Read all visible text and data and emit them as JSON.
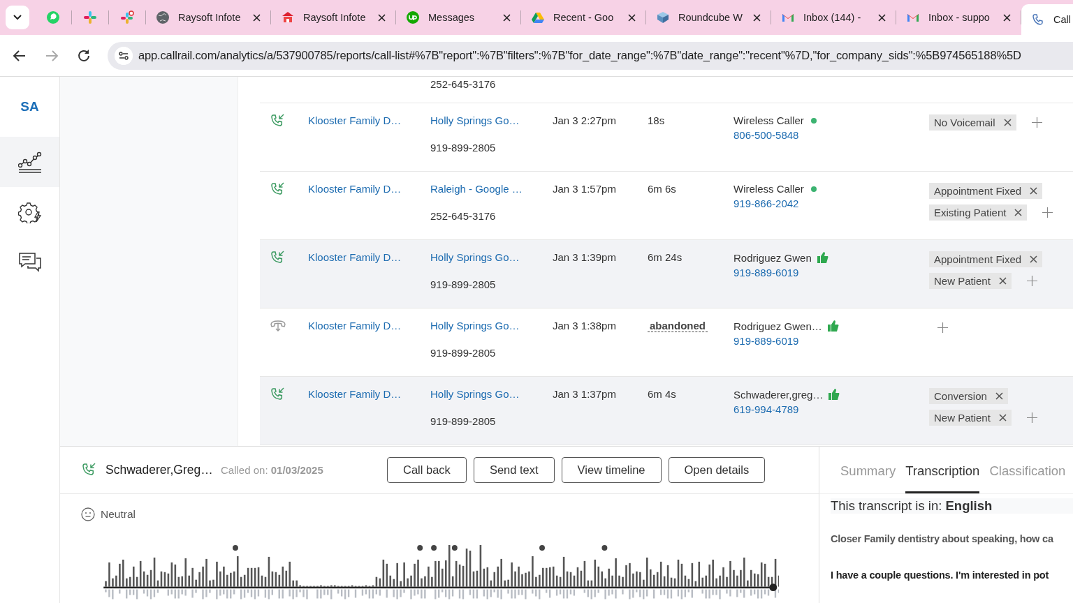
{
  "browser": {
    "tabs": [
      {
        "kind": "whatsapp",
        "selected": false
      },
      {
        "kind": "slack",
        "selected": false
      },
      {
        "kind": "slack_badge",
        "selected": false
      },
      {
        "kind": "globe",
        "title": "Raysoft Infote",
        "selected": false
      },
      {
        "kind": "portal",
        "title": "Raysoft Infote",
        "selected": false
      },
      {
        "kind": "upwork",
        "title": "Messages",
        "selected": false
      },
      {
        "kind": "drive",
        "title": "Recent - Goo",
        "selected": false
      },
      {
        "kind": "roundcube",
        "title": "Roundcube W",
        "selected": false
      },
      {
        "kind": "gmail",
        "title": "Inbox (144) -",
        "selected": false
      },
      {
        "kind": "gmail",
        "title": "Inbox - suppo",
        "selected": false
      },
      {
        "kind": "phone",
        "title": "Call",
        "selected": true
      }
    ],
    "url": "app.callrail.com/analytics/a/537900785/reports/call-list#%7B\"report\":%7B\"filters\":%7B\"for_date_range\":%7B\"date_range\":\"recent\"%7D,\"for_company_sids\":%5B974565188%5D"
  },
  "sidebar": {
    "account": "SA",
    "items": [
      {
        "kind": "analytics",
        "selected": true
      },
      {
        "kind": "settings",
        "selected": false
      },
      {
        "kind": "messages",
        "selected": false
      }
    ]
  },
  "calls": {
    "partial_row": {
      "tracking_number": "252-645-3176"
    },
    "rows": [
      {
        "kind": "answered",
        "highlighted": false,
        "company": "Klooster Family D…",
        "source": "Holly Springs Go…",
        "tracking_number": "919-899-2805",
        "time": "Jan 3 2:27pm",
        "duration": "18s",
        "caller": {
          "kind": "dot",
          "name": "Wireless Caller",
          "phone": "806-500-5848"
        },
        "tags": [
          "No Voicemail"
        ]
      },
      {
        "kind": "answered",
        "highlighted": false,
        "company": "Klooster Family D…",
        "source": "Raleigh - Google …",
        "tracking_number": "252-645-3176",
        "time": "Jan 3 1:57pm",
        "duration": "6m 6s",
        "caller": {
          "kind": "dot",
          "name": "Wireless Caller",
          "phone": "919-866-2042"
        },
        "tags": [
          "Appointment Fixed",
          "Existing Patient"
        ]
      },
      {
        "kind": "answered",
        "highlighted": true,
        "company": "Klooster Family D…",
        "source": "Holly Springs Go…",
        "tracking_number": "919-899-2805",
        "time": "Jan 3 1:39pm",
        "duration": "6m 24s",
        "caller": {
          "kind": "thumb",
          "name": "Rodriguez Gwen",
          "phone": "919-889-6019"
        },
        "tags": [
          "Appointment Fixed",
          "New Patient"
        ]
      },
      {
        "kind": "abandoned",
        "highlighted": false,
        "company": "Klooster Family D…",
        "source": "Holly Springs Go…",
        "tracking_number": "919-899-2805",
        "time": "Jan 3 1:38pm",
        "duration": "abandoned",
        "caller": {
          "kind": "thumb",
          "name": "Rodriguez Gwen…",
          "phone": "919-889-6019"
        }
      },
      {
        "kind": "answered",
        "highlighted": true,
        "company": "Klooster Family D…",
        "source": "Holly Springs Go…",
        "tracking_number": "919-899-2805",
        "time": "Jan 3 1:37pm",
        "duration": "6m 4s",
        "caller": {
          "kind": "thumb",
          "name": "Schwaderer,greg…",
          "phone": "619-994-4789"
        },
        "tags": [
          "Conversion",
          "New Patient"
        ]
      }
    ]
  },
  "call_panel": {
    "caller": "Schwaderer,Greg…",
    "called_on_label": "Called on:",
    "called_on": "01/03/2025",
    "buttons": [
      "Call back",
      "Send text",
      "View timeline",
      "Open details"
    ],
    "sentiment": "Neutral",
    "tabs": [
      {
        "label": "Summary",
        "selected": false
      },
      {
        "label": "Transcription",
        "selected": true
      },
      {
        "label": "Classification",
        "selected": false
      }
    ],
    "transcript_language_label": "This transcript is in:",
    "transcript_language": "English",
    "transcript": [
      {
        "kind": "agent",
        "text": "Closer Family dentistry about speaking, how ca"
      },
      {
        "kind": "caller",
        "text": "I have a couple questions. I'm interested in pot"
      }
    ]
  }
}
